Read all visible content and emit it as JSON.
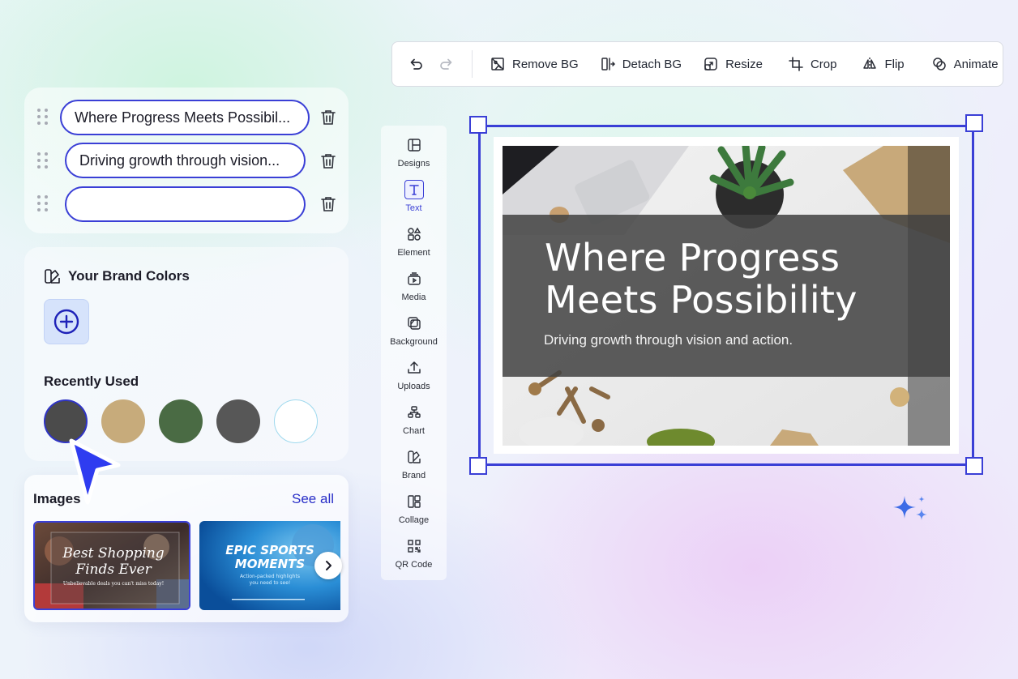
{
  "toolbar": {
    "undo_label": "",
    "redo_label": "",
    "remove_bg": "Remove BG",
    "detach_bg": "Detach BG",
    "resize": "Resize",
    "crop": "Crop",
    "flip": "Flip",
    "animate": "Animate"
  },
  "text_fields": [
    {
      "value": "Where Progress Meets Possibil..."
    },
    {
      "value": "Driving growth through vision..."
    },
    {
      "value": ""
    }
  ],
  "brand": {
    "heading": "Your Brand Colors",
    "recent_heading": "Recently Used",
    "recent_colors": [
      "#4b4b4b",
      "#c7ab7b",
      "#4a6b44",
      "#575757",
      "#ffffff"
    ]
  },
  "images": {
    "heading": "Images",
    "see_all": "See all",
    "thumbs": [
      {
        "title_line1": "Best Shopping",
        "title_line2": "Finds Ever",
        "caption": "Unbelievable deals you can't miss today!"
      },
      {
        "title_line1": "EPIC SPORTS",
        "title_line2": "MOMENTS",
        "caption_line1": "Action-packed highlights",
        "caption_line2": "you need to see!"
      }
    ]
  },
  "sidenav": {
    "items": [
      {
        "label": "Designs",
        "icon": "layout-icon"
      },
      {
        "label": "Text",
        "icon": "text-icon"
      },
      {
        "label": "Element",
        "icon": "shapes-icon"
      },
      {
        "label": "Media",
        "icon": "media-icon"
      },
      {
        "label": "Background",
        "icon": "background-icon"
      },
      {
        "label": "Uploads",
        "icon": "upload-icon"
      },
      {
        "label": "Chart",
        "icon": "chart-icon"
      },
      {
        "label": "Brand",
        "icon": "brand-icon"
      },
      {
        "label": "Collage",
        "icon": "collage-icon"
      },
      {
        "label": "QR Code",
        "icon": "qr-code-icon"
      }
    ],
    "active": "Text"
  },
  "canvas": {
    "title_line1": "Where Progress",
    "title_line2": "Meets Possibility",
    "subtitle": "Driving growth through vision and action."
  },
  "colors": {
    "accent": "#3a3fd6",
    "banner": "#5a5a5a"
  }
}
